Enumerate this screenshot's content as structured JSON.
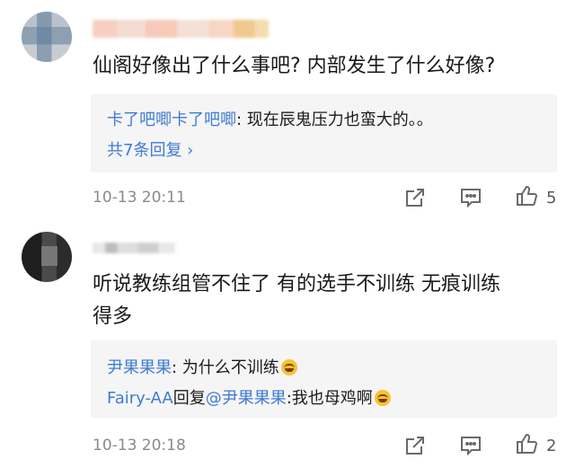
{
  "comments": [
    {
      "text": "仙阁好像出了什么事吧? 内部发生了什么好像?",
      "replies": [
        {
          "name": "卡了吧唧卡了吧唧",
          "sep": ": ",
          "text": "现在辰鬼压力也蛮大的。。",
          "emoji": false
        }
      ],
      "more": "共7条回复 ›",
      "time": "10-13 20:11",
      "likes": "5"
    },
    {
      "text_line1": "听说教练组管不住了 有的选手不训练 无痕训练",
      "text_line2": "得多",
      "replies": [
        {
          "name": "尹果果果",
          "sep": ": ",
          "text": "为什么不训练",
          "emoji": true
        },
        {
          "name": "Fairy-AA",
          "prefix": "回复",
          "mention": "@尹果果果",
          "sep": ":",
          "text": "我也母鸡啊",
          "emoji": true
        }
      ],
      "time": "10-13 20:18",
      "likes": "2"
    }
  ],
  "icons": [
    "share-icon",
    "comment-icon",
    "like-icon"
  ],
  "colors": {
    "link": "#3f7bd3",
    "meta": "#8a8a8a",
    "reply_bg": "#f5f5f5"
  }
}
